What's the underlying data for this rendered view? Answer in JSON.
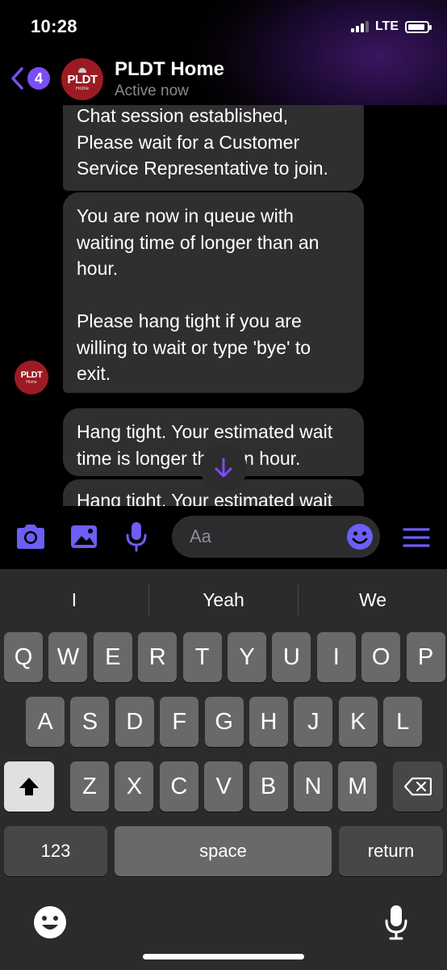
{
  "status_bar": {
    "time": "10:28",
    "network": "LTE"
  },
  "header": {
    "back_count": "4",
    "avatar_brand": "PLDT",
    "avatar_sub": "Home",
    "contact_name": "PLDT Home",
    "contact_status": "Active now"
  },
  "messages": [
    {
      "lines": [
        "Chat session established,",
        "Please wait for a Customer",
        "Service Representative to join."
      ]
    },
    {
      "lines": [
        "You are now in queue with",
        "waiting time of longer than an",
        "hour.",
        "",
        "Please hang tight if you are",
        "willing to wait or type 'bye' to",
        "exit."
      ]
    },
    {
      "lines": [
        "Hang tight. Your estimated wait",
        "time is longer than an hour."
      ]
    },
    {
      "lines": [
        "Hang tight. Your estimated wait"
      ]
    }
  ],
  "composer": {
    "placeholder": "Aa"
  },
  "keyboard": {
    "suggestions": [
      "I",
      "Yeah",
      "We"
    ],
    "row1": [
      "Q",
      "W",
      "E",
      "R",
      "T",
      "Y",
      "U",
      "I",
      "O",
      "P"
    ],
    "row2": [
      "A",
      "S",
      "D",
      "F",
      "G",
      "H",
      "J",
      "K",
      "L"
    ],
    "row3": [
      "Z",
      "X",
      "C",
      "V",
      "B",
      "N",
      "M"
    ],
    "numbers_label": "123",
    "space_label": "space",
    "return_label": "return"
  },
  "colors": {
    "accent": "#7b4df5",
    "brand": "#9b1b24",
    "bubble": "#2f2f31"
  },
  "icons": [
    "back-chevron-icon",
    "camera-icon",
    "photo-icon",
    "microphone-icon",
    "emoji-icon",
    "menu-icon",
    "arrow-down-icon",
    "shift-icon",
    "delete-icon",
    "keyboard-emoji-icon",
    "dictation-icon"
  ]
}
